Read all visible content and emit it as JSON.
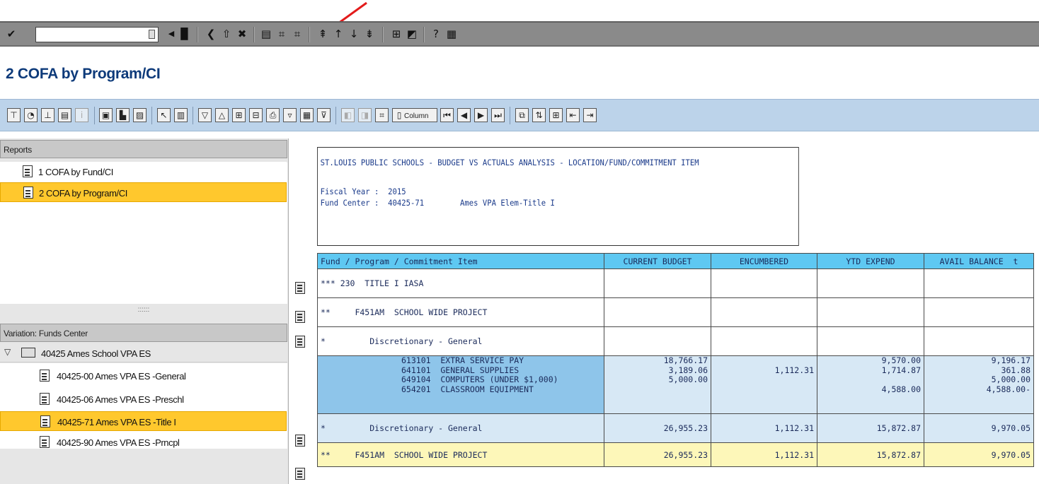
{
  "std_toolbar": {
    "command_field_value": "",
    "icons": [
      "enter-icon",
      "dropdown-icon",
      "back-nav-icon",
      "save-icon",
      "back-icon",
      "exit-icon",
      "cancel-icon",
      "print-icon",
      "find-icon",
      "find-next-icon",
      "first-page-icon",
      "previous-page-icon",
      "next-page-icon",
      "last-page-icon",
      "create-session-icon",
      "shortcut-icon",
      "help-icon",
      "layout-icon"
    ]
  },
  "page": {
    "title": "2 COFA by Program/CI"
  },
  "app_toolbar": {
    "column_button_label": "Column",
    "icons": [
      "hierarchy-icon",
      "graphic-icon",
      "structure-icon",
      "table-icon",
      "info-icon",
      "export-icon",
      "local-file-icon",
      "spreadsheet-icon",
      "drilldown-icon",
      "columns-icon",
      "expand-icon",
      "collapse-icon",
      "expand-all-icon",
      "collapse-all-icon",
      "print-icon",
      "filter-icon",
      "display-icon",
      "filter-funnel-icon",
      "left-col-icon",
      "right-col-icon",
      "find-icon",
      "first-col-icon",
      "prev-col-icon",
      "next-col-icon",
      "last-col-icon",
      "switch-icon",
      "sort-icon",
      "layout-icon",
      "col-left-icon",
      "col-right-icon"
    ]
  },
  "left_panel": {
    "reports_header": "Reports",
    "reports": [
      {
        "label": "1 COFA by Fund/CI",
        "selected": false
      },
      {
        "label": "2 COFA by Program/CI",
        "selected": true
      }
    ],
    "splitter_dots": "::::::",
    "variation_header": "Variation: Funds Center",
    "folder": {
      "label": "40425 Ames School VPA ES",
      "expanded": true
    },
    "variations": [
      {
        "label": "40425-00 Ames VPA ES -General",
        "selected": false
      },
      {
        "label": "40425-06 Ames VPA ES -Preschl",
        "selected": false
      },
      {
        "label": "40425-71 Ames VPA ES -Title I",
        "selected": true
      },
      {
        "label": "40425-90 Ames VPA ES -Prncpl",
        "selected": false
      }
    ]
  },
  "report": {
    "title_line": "ST.LOUIS PUBLIC SCHOOLS - BUDGET VS ACTUALS ANALYSIS - LOCATION/FUND/COMMITMENT ITEM",
    "fiscal_year_line": "Fiscal Year :  2015",
    "fund_center_line": "Fund Center :  40425-71        Ames VPA Elem-Title I",
    "columns": [
      "Fund / Program / Commitment Item",
      "CURRENT BUDGET",
      "ENCUMBERED",
      "YTD EXPEND",
      "AVAIL BALANCE  t"
    ],
    "rows": {
      "r1": {
        "label": "*** 230  TITLE I IASA"
      },
      "r2": {
        "label": "**     F451AM  SCHOOL WIDE PROJECT"
      },
      "r3": {
        "label": "*         Discretionary - General"
      },
      "detail": [
        {
          "label": "613101  EXTRA SERVICE PAY",
          "budget": "18,766.17",
          "encumbered": "",
          "ytd": "9,570.00",
          "avail": "9,196.17"
        },
        {
          "label": "641101  GENERAL SUPPLIES",
          "budget": "3,189.06",
          "encumbered": "1,112.31",
          "ytd": "1,714.87",
          "avail": "361.88"
        },
        {
          "label": "649104  COMPUTERS (UNDER $1,000)",
          "budget": "5,000.00",
          "encumbered": "",
          "ytd": "",
          "avail": "5,000.00"
        },
        {
          "label": "654201  CLASSROOM EQUIPMENT",
          "budget": "",
          "encumbered": "",
          "ytd": "4,588.00",
          "avail": "4,588.00-"
        }
      ],
      "subtotal": {
        "label": "*         Discretionary - General",
        "budget": "26,955.23",
        "encumbered": "1,112.31",
        "ytd": "15,872.87",
        "avail": "9,970.05"
      },
      "total": {
        "label": "**     F451AM  SCHOOL WIDE PROJECT",
        "budget": "26,955.23",
        "encumbered": "1,112.31",
        "ytd": "15,872.87",
        "avail": "9,970.05"
      }
    }
  },
  "colors": {
    "accent_arrow": "#e31b1b",
    "selection": "#ffc82d",
    "table_header": "#5ec8f2",
    "total_row": "#fdf7b9"
  }
}
